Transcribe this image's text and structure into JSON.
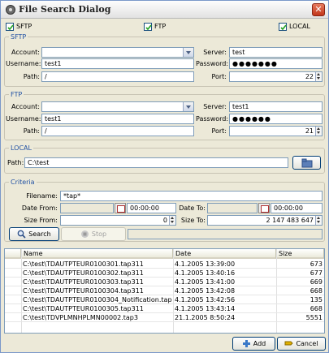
{
  "window": {
    "title": "File Search Dialog"
  },
  "options": {
    "sftp": "SFTP",
    "ftp": "FTP",
    "local": "LOCAL"
  },
  "sftp": {
    "title": "SFTP",
    "account_label": "Account:",
    "account_value": "",
    "username_label": "Username:",
    "username_value": "test1",
    "path_label": "Path:",
    "path_value": "/",
    "server_label": "Server:",
    "server_value": "test",
    "password_label": "Password:",
    "password_value": "●●●●●●●",
    "port_label": "Port:",
    "port_value": "22"
  },
  "ftp": {
    "title": "FTP",
    "account_label": "Account:",
    "account_value": "",
    "username_label": "Username:",
    "username_value": "test1",
    "path_label": "Path:",
    "path_value": "/",
    "server_label": "Server:",
    "server_value": "test1",
    "password_label": "Password:",
    "password_value": "●●●●●●",
    "port_label": "Port:",
    "port_value": "21"
  },
  "local": {
    "title": "LOCAL",
    "path_label": "Path:",
    "path_value": "C:\\test"
  },
  "criteria": {
    "title": "Criteria",
    "filename_label": "Filename:",
    "filename_value": "*tap*",
    "date_from_label": "Date From:",
    "date_from_value": "",
    "time_from_value": "00:00:00",
    "date_to_label": "Date To:",
    "date_to_value": "",
    "time_to_value": "00:00:00",
    "size_from_label": "Size From:",
    "size_from_value": "0",
    "size_to_label": "Size To:",
    "size_to_value": "2 147 483 647"
  },
  "actions": {
    "search": "Search",
    "stop": "Stop",
    "add": "Add",
    "cancel": "Cancel"
  },
  "results": {
    "columns": [
      "Name",
      "Date",
      "Size"
    ],
    "rows": [
      {
        "name": "C:\\test\\TDAUTPTEUR0100301.tap311",
        "date": "4.1.2005 13:39:00",
        "size": "673"
      },
      {
        "name": "C:\\test\\TDAUTPTEUR0100302.tap311",
        "date": "4.1.2005 13:40:16",
        "size": "677"
      },
      {
        "name": "C:\\test\\TDAUTPTEUR0100303.tap311",
        "date": "4.1.2005 13:41:00",
        "size": "669"
      },
      {
        "name": "C:\\test\\TDAUTPTEUR0100304.tap311",
        "date": "4.1.2005 13:42:08",
        "size": "668"
      },
      {
        "name": "C:\\test\\TDAUTPTEUR0100304_Notification.tap311",
        "date": "4.1.2005 13:42:56",
        "size": "135"
      },
      {
        "name": "C:\\test\\TDAUTPTEUR0100305.tap311",
        "date": "4.1.2005 13:43:14",
        "size": "668"
      },
      {
        "name": "C:\\test\\TDVPLMNHPLMN00002.tap3",
        "date": "21.1.2005 8:50:24",
        "size": "5551"
      }
    ]
  },
  "colors": {
    "group_title": "#2151a3",
    "checkmark": "#21a121",
    "title_close": "#c1361b"
  }
}
